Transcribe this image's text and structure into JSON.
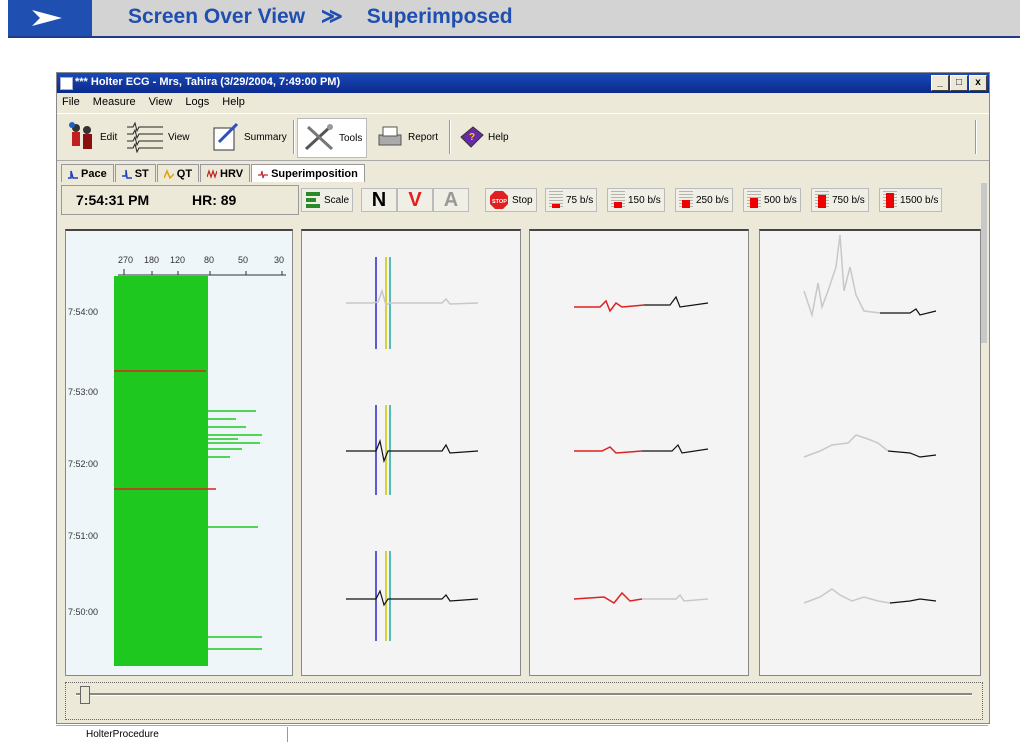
{
  "banner": {
    "title": "Screen Over View",
    "separator": "≫",
    "section": "Superimposed",
    "colors": {
      "bg": "#d3d3d3",
      "accent": "#1f4fb0"
    }
  },
  "window": {
    "title": "*** Holter ECG - Mrs, Tahira (3/29/2004, 7:49:00 PM)",
    "buttons": [
      "_",
      "□",
      "x"
    ]
  },
  "menu": [
    "File",
    "Measure",
    "View",
    "Logs",
    "Help"
  ],
  "toolbar": {
    "edit": "Edit",
    "view": "View",
    "summary": "Summary",
    "tools": "Tools",
    "report": "Report",
    "help": "Help"
  },
  "tabs": [
    {
      "label": "Pace",
      "icon": "pace-icon"
    },
    {
      "label": "ST",
      "icon": "st-icon"
    },
    {
      "label": "QT",
      "icon": "qt-icon"
    },
    {
      "label": "HRV",
      "icon": "hrv-icon"
    },
    {
      "label": "Superimposition",
      "icon": "superimposition-icon",
      "active": true
    }
  ],
  "info": {
    "time": "7:54:31 PM",
    "hr": "HR: 89"
  },
  "controls": {
    "scale": "Scale",
    "normal_label": "N",
    "ventricular_label": "V",
    "artifact_label": "A",
    "stop": "Stop",
    "stop_icon_text": "STOP",
    "speeds": [
      "75 b/s",
      "150 b/s",
      "250 b/s",
      "500 b/s",
      "750 b/s",
      "1500 b/s"
    ],
    "speed_levels": [
      0.25,
      0.35,
      0.5,
      0.65,
      0.8,
      0.95
    ]
  },
  "trend": {
    "axis_ticks": [
      "270",
      "180",
      "120",
      "80",
      "50",
      "30"
    ],
    "time_labels": [
      "7:54:00",
      "7:53:00",
      "7:52:00",
      "7:51:00",
      "7:50:00"
    ]
  },
  "status": {
    "pane1": "HolterProcedure"
  },
  "colors": {
    "green": "#1ec81e",
    "red": "#e02020",
    "blue": "#2828c8",
    "yellow": "#c8c800",
    "teal": "#20a8a0"
  }
}
